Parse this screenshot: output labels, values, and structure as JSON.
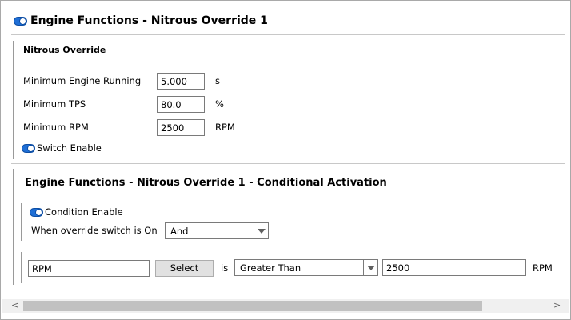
{
  "panel": {
    "title": "Engine Functions - Nitrous Override 1"
  },
  "nitrous_override": {
    "heading": "Nitrous Override",
    "fields": [
      {
        "label": "Minimum Engine Running",
        "value": "5.000",
        "unit": "s"
      },
      {
        "label": "Minimum TPS",
        "value": "80.0",
        "unit": "%"
      },
      {
        "label": "Minimum RPM",
        "value": "2500",
        "unit": "RPM"
      }
    ],
    "switch_enable_label": "Switch Enable"
  },
  "conditional": {
    "title": "Engine Functions - Nitrous Override 1 - Conditional Activation",
    "condition_enable_label": "Condition Enable",
    "when_label": "When override switch is On",
    "when_value": "And",
    "row": {
      "channel": "RPM",
      "select_label": "Select",
      "is_label": "is",
      "comparator": "Greater Than",
      "value": "2500",
      "unit": "RPM"
    }
  },
  "scrollbar": {
    "left_arrow": "<",
    "right_arrow": ">"
  }
}
